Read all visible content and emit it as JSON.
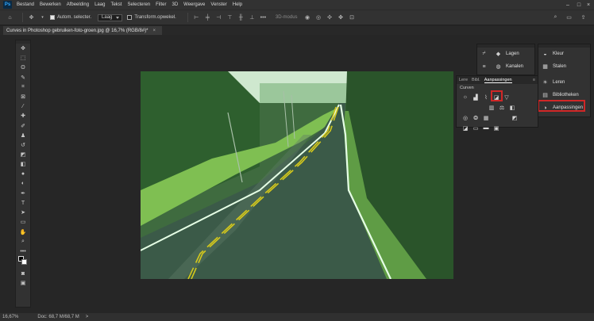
{
  "app": {
    "logo": "Ps",
    "menu": [
      "Bestand",
      "Bewerken",
      "Afbeelding",
      "Laag",
      "Tekst",
      "Selecteren",
      "Filter",
      "3D",
      "Weergave",
      "Venster",
      "Help"
    ]
  },
  "options": {
    "auto_select_label": "Autom. selecter.",
    "layer_select": "Laag",
    "transform_label": "Transform.opwekel.",
    "mode_3d": "3D-modus"
  },
  "document": {
    "tab_title": "Curves in Photoshop gebruiken-foto-groen.jpg @ 16,7% (RGB/8#)*",
    "close": "×"
  },
  "status": {
    "zoom": "16,67%",
    "doc": "Doc: 68,7 M/68,7 M",
    "arrow": ">"
  },
  "panels": {
    "layers_label": "Lagen",
    "channels_label": "Kanalen",
    "color_label": "Kleur",
    "swatches_label": "Stalen",
    "learn_label": "Leren",
    "libraries_label": "Bibliotheken",
    "adjustments_label": "Aanpassingen"
  },
  "adjustments_panel": {
    "tabs": [
      "Lere",
      "Bibl.",
      "Aanpassingen"
    ],
    "subtitle": "Curven"
  },
  "colors": {
    "accent_highlight": "#d02727",
    "panel_bg": "#323232",
    "canvas_bg": "#262626"
  }
}
